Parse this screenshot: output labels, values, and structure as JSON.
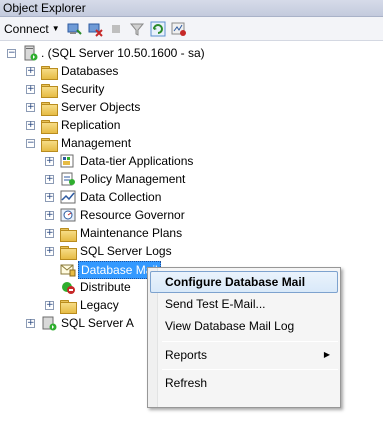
{
  "window": {
    "title": "Object Explorer"
  },
  "toolbar": {
    "connect_label": "Connect",
    "buttons": [
      "connect-object-explorer-icon",
      "disconnect-icon",
      "stop-icon",
      "filter-icon",
      "refresh-icon",
      "activity-monitor-icon"
    ]
  },
  "tree": {
    "server": ". (SQL Server 10.50.1600 - sa)",
    "databases": "Databases",
    "security": "Security",
    "server_objects": "Server Objects",
    "replication": "Replication",
    "management": "Management",
    "data_tier": "Data-tier Applications",
    "policy_management": "Policy Management",
    "data_collection": "Data Collection",
    "resource_governor": "Resource Governor",
    "maintenance_plans": "Maintenance Plans",
    "sql_server_logs": "SQL Server Logs",
    "database_mail": "Database Mail",
    "distributed": "Distribute",
    "legacy": "Legacy",
    "sql_server_agent": "SQL Server A"
  },
  "context_menu": {
    "configure": "Configure Database Mail",
    "send_test": "Send Test E-Mail...",
    "view_log": "View Database Mail Log",
    "reports": "Reports",
    "refresh": "Refresh"
  },
  "colors": {
    "selection": "#3399ff",
    "menu_highlight_border": "#7da2ce",
    "folder": "#e6bb44"
  }
}
